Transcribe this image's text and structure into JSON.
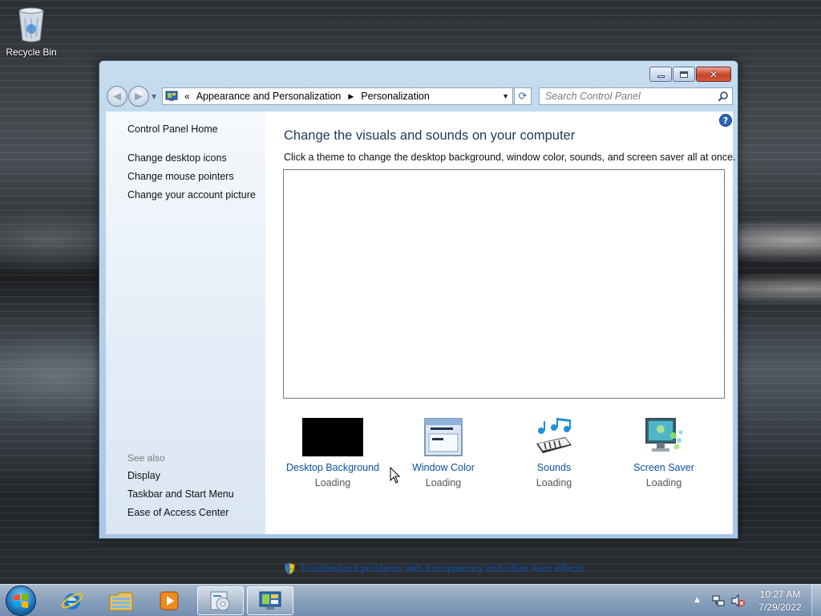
{
  "desktop": {
    "recycle_bin_label": "Recycle Bin"
  },
  "window": {
    "controls": {
      "minimize": "minimize",
      "maximize": "maximize",
      "close": "close"
    }
  },
  "navbar": {
    "breadcrumb_prefix": "«",
    "breadcrumb": [
      "Appearance and Personalization",
      "Personalization"
    ],
    "search_placeholder": "Search Control Panel"
  },
  "sidebar": {
    "home": "Control Panel Home",
    "tasks": [
      "Change desktop icons",
      "Change mouse pointers",
      "Change your account picture"
    ],
    "see_also_label": "See also",
    "see_also": [
      "Display",
      "Taskbar and Start Menu",
      "Ease of Access Center"
    ]
  },
  "main": {
    "heading": "Change the visuals and sounds on your computer",
    "subtext": "Click a theme to change the desktop background, window color, sounds, and screen saver all at once.",
    "tiles": [
      {
        "title": "Desktop Background",
        "status": "Loading",
        "icon": "desktop-background-swatch"
      },
      {
        "title": "Window Color",
        "status": "Loading",
        "icon": "window-color-icon"
      },
      {
        "title": "Sounds",
        "status": "Loading",
        "icon": "sounds-icon"
      },
      {
        "title": "Screen Saver",
        "status": "Loading",
        "icon": "screen-saver-icon"
      }
    ],
    "troubleshoot_link": "Troubleshoot problems with transparency and other Aero effects"
  },
  "taskbar": {
    "buttons": [
      "start-orb",
      "internet-explorer-icon",
      "windows-explorer-icon",
      "media-player-icon",
      "media-center-icon",
      "control-panel-icon"
    ],
    "time": "10:27 AM",
    "date": "7/29/2022"
  },
  "colors": {
    "link": "#0b4fa3",
    "heading": "#1e395b",
    "window_frame": "#b8d1ea",
    "close_button": "#c7432a"
  }
}
